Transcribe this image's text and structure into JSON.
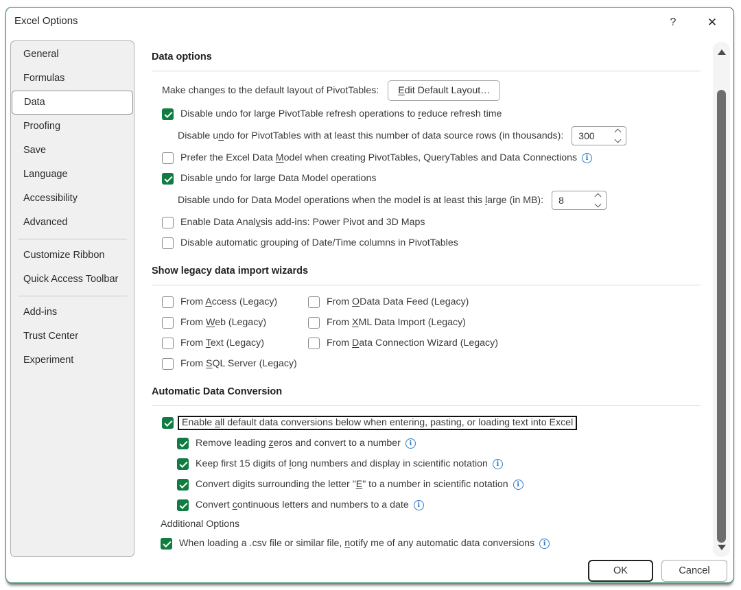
{
  "dialog": {
    "title": "Excel Options",
    "ok_label": "OK",
    "cancel_label": "Cancel"
  },
  "icons": {
    "help": "?",
    "close": "✕",
    "info": "i"
  },
  "sidebar": {
    "selected": "Data",
    "items": [
      {
        "label": "General"
      },
      {
        "label": "Formulas"
      },
      {
        "label": "Data"
      },
      {
        "label": "Proofing"
      },
      {
        "label": "Save"
      },
      {
        "label": "Language"
      },
      {
        "label": "Accessibility"
      },
      {
        "label": "Advanced"
      },
      {
        "label": "Customize Ribbon"
      },
      {
        "label": "Quick Access Toolbar"
      },
      {
        "label": "Add-ins"
      },
      {
        "label": "Trust Center"
      },
      {
        "label": "Experiment"
      }
    ]
  },
  "data_options": {
    "heading": "Data options",
    "pivot_layout_label": "Make changes to the default layout of PivotTables:",
    "edit_layout_button": {
      "key": "E",
      "post": "dit Default Layout…"
    },
    "disable_undo_pivot": {
      "pre": "Disable undo for large PivotTable refresh operations to ",
      "key": "r",
      "post": "educe refresh time",
      "checked": true
    },
    "pivot_rows_label": {
      "pre": "Disable u",
      "key": "n",
      "post": "do for PivotTables with at least this number of data source rows (in thousands):"
    },
    "pivot_rows_value": "300",
    "prefer_data_model": {
      "pre": "Prefer the Excel Data ",
      "key": "M",
      "post": "odel when creating PivotTables, QueryTables and Data Connections",
      "checked": false
    },
    "disable_undo_dm": {
      "pre": "Disable ",
      "key": "u",
      "post": "ndo for large Data Model operations",
      "checked": true
    },
    "dm_size_label": {
      "pre": "Disable undo for Data Model operations when the model is at least this ",
      "key": "l",
      "post": "arge (in MB):"
    },
    "dm_size_value": "8",
    "enable_analysis": {
      "pre": "Enable Data Anal",
      "key": "y",
      "post": "sis add-ins: Power Pivot and 3D Maps",
      "checked": false
    },
    "disable_grouping": {
      "pre": "Disable automatic ",
      "key": "g",
      "post": "rouping of Date/Time columns in PivotTables",
      "checked": false
    }
  },
  "legacy_wizards": {
    "heading": "Show legacy data import wizards",
    "access": {
      "pre": "From ",
      "key": "A",
      "post": "ccess (Legacy)",
      "checked": false
    },
    "web": {
      "pre": "From ",
      "key": "W",
      "post": "eb (Legacy)",
      "checked": false
    },
    "text": {
      "pre": "From ",
      "key": "T",
      "post": "ext (Legacy)",
      "checked": false
    },
    "sql": {
      "pre": "From ",
      "key": "S",
      "post": "QL Server (Legacy)",
      "checked": false
    },
    "odata": {
      "pre": "From ",
      "key": "O",
      "post": "Data Data Feed (Legacy)",
      "checked": false
    },
    "xml": {
      "pre": "From ",
      "key": "X",
      "post": "ML Data Import (Legacy)",
      "checked": false
    },
    "dcw": {
      "pre": "From ",
      "key": "D",
      "post": "ata Connection Wizard (Legacy)",
      "checked": false
    }
  },
  "auto_conversion": {
    "heading": "Automatic Data Conversion",
    "enable_all": {
      "pre": "Enable ",
      "key": "a",
      "post": "ll default data conversions below when entering, pasting, or loading text into Excel",
      "checked": true
    },
    "remove_zeros": {
      "pre": "Remove leading ",
      "key": "z",
      "post": "eros and convert to a number",
      "checked": true
    },
    "keep_digits": {
      "pre": "Keep first 15 digits of ",
      "key": "l",
      "post": "ong numbers and display in scientific notation",
      "checked": true
    },
    "convert_e": {
      "pre": "Convert digits surrounding the letter \"",
      "key": "E",
      "post": "\" to a number in scientific notation",
      "checked": true
    },
    "convert_date": {
      "pre": "Convert ",
      "key": "c",
      "post": "ontinuous letters and numbers to a date",
      "checked": true
    },
    "additional_label": "Additional Options",
    "csv_notify": {
      "pre": "When loading a .csv file or similar file, ",
      "key": "n",
      "post": "otify me of any automatic data conversions",
      "checked": true
    }
  }
}
